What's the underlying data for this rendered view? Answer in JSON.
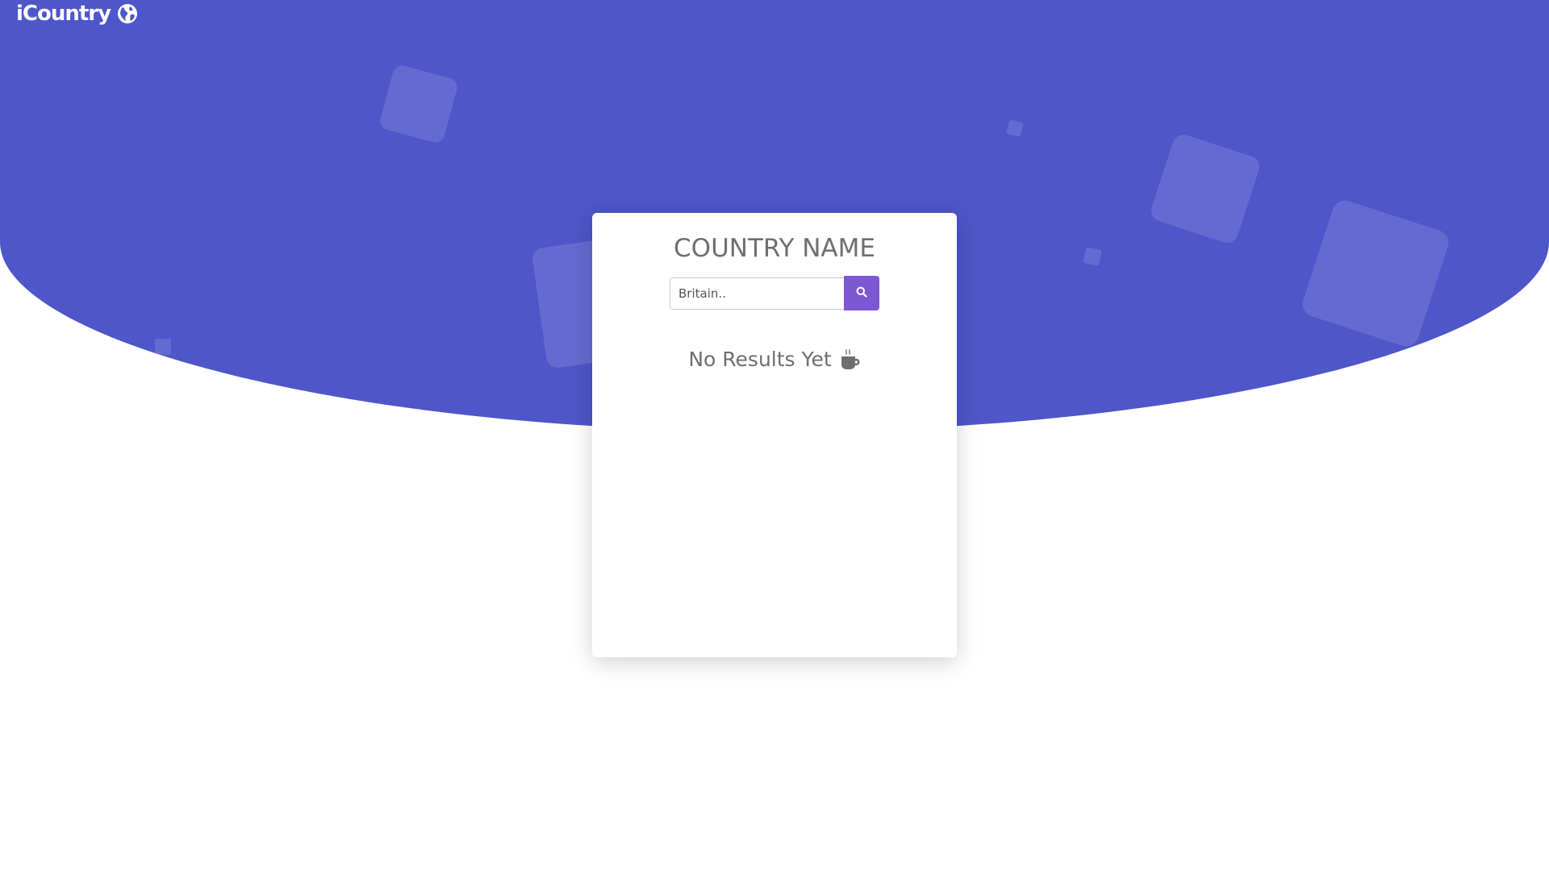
{
  "brand": {
    "name": "iCountry",
    "icon": "globe-icon"
  },
  "colors": {
    "hero": "#4e56c9",
    "accent": "#7e57d2",
    "text_muted": "#6f6f6f"
  },
  "card": {
    "title": "COUNTRY NAME",
    "search": {
      "placeholder": "Britain..",
      "value": "",
      "button_icon": "search-icon"
    },
    "status": {
      "text": "No Results Yet",
      "icon": "coffee-icon"
    }
  }
}
